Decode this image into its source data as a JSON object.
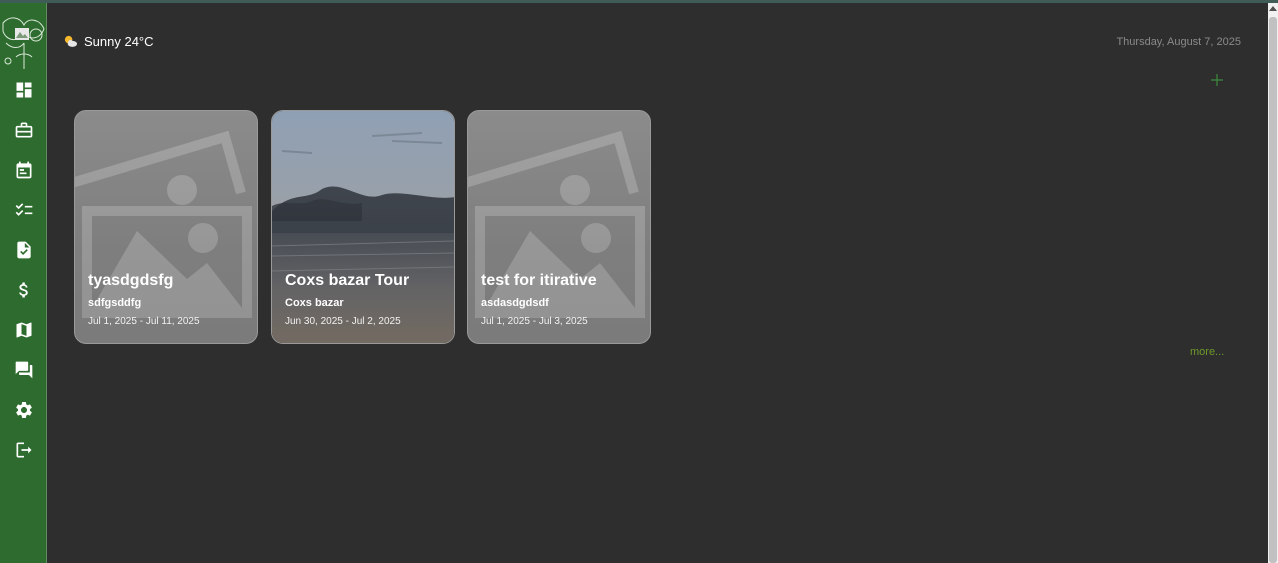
{
  "weather": {
    "icon": "partly-sunny-icon",
    "text": "Sunny 24°C"
  },
  "date": "Thursday, August 7, 2025",
  "colors": {
    "sidebar": "#2e6b2e",
    "background": "#2e2e2e",
    "accent": "#6d9a2a"
  },
  "sidebar": {
    "items": [
      {
        "name": "dashboard-icon"
      },
      {
        "name": "briefcase-icon"
      },
      {
        "name": "calendar-icon"
      },
      {
        "name": "checklist-icon"
      },
      {
        "name": "document-check-icon"
      },
      {
        "name": "dollar-icon"
      },
      {
        "name": "map-icon"
      },
      {
        "name": "chat-icon"
      },
      {
        "name": "gear-icon"
      },
      {
        "name": "logout-icon"
      }
    ]
  },
  "trips": [
    {
      "title": "tyasdgdsfg",
      "subtitle": "sdfgsddfg",
      "dates": "Jul 1, 2025 - Jul 11, 2025",
      "image": "placeholder-image-icon"
    },
    {
      "title": "Coxs bazar Tour",
      "subtitle": "Coxs bazar",
      "dates": "Jun 30, 2025 - Jul 2, 2025",
      "image": "beach-photo"
    },
    {
      "title": "test for itirative",
      "subtitle": "asdasdgdsdf",
      "dates": "Jul 1, 2025 - Jul 3, 2025",
      "image": "placeholder-image-icon"
    }
  ],
  "more_label": "more..."
}
